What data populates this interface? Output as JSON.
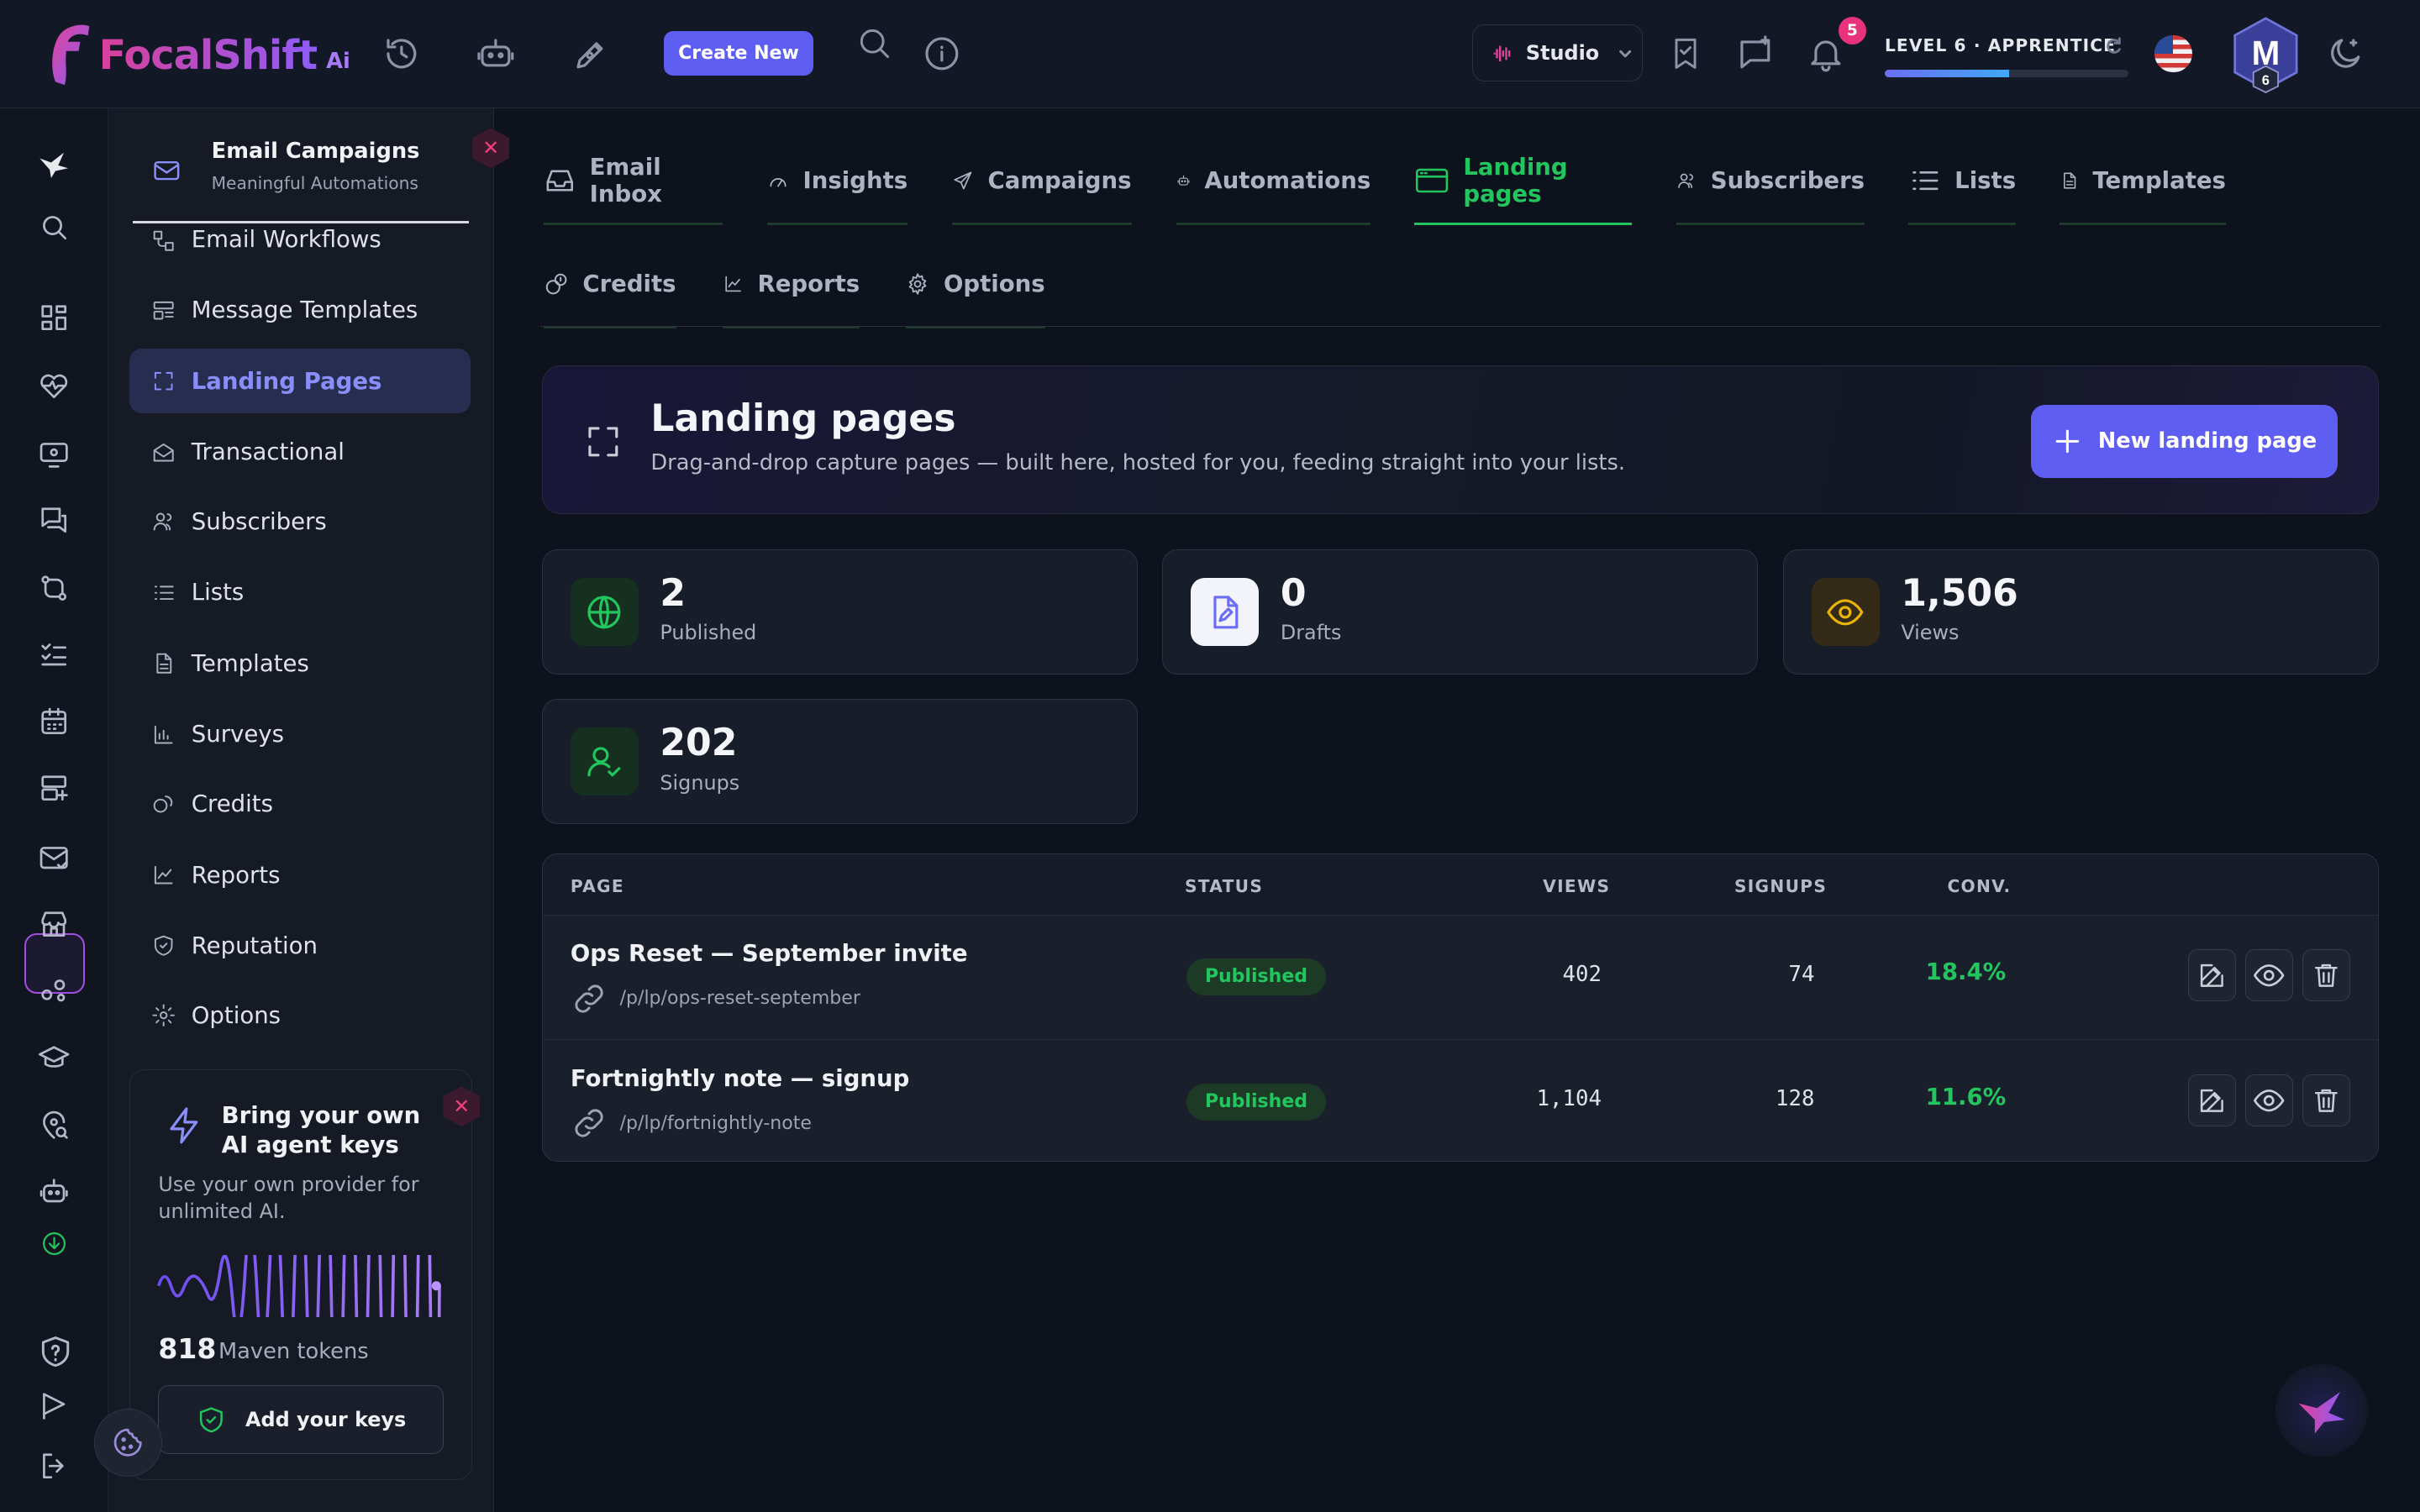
{
  "app": {
    "logo_text": "FocalShift",
    "logo_ai": "Ai"
  },
  "topbar": {
    "create_label": "Create New",
    "studio_label": "Studio",
    "notifications_count": "5",
    "level_label": "LEVEL 6 · APPRENTICE",
    "level_progress": 0.51,
    "avatar_initial": "M",
    "avatar_level": "6"
  },
  "sidebar": {
    "title": "Email Campaigns",
    "subtitle": "Meaningful Automations",
    "items": [
      {
        "label": "Email Workflows",
        "icon": "workflow-icon"
      },
      {
        "label": "Message Templates",
        "icon": "template-icon"
      },
      {
        "label": "Landing Pages",
        "icon": "frame-icon",
        "active": true
      },
      {
        "label": "Transactional",
        "icon": "envelope-open-icon"
      },
      {
        "label": "Subscribers",
        "icon": "users-icon"
      },
      {
        "label": "Lists",
        "icon": "list-icon"
      },
      {
        "label": "Templates",
        "icon": "document-icon"
      },
      {
        "label": "Surveys",
        "icon": "bar-chart-icon"
      },
      {
        "label": "Credits",
        "icon": "coins-icon"
      },
      {
        "label": "Reports",
        "icon": "line-chart-icon"
      },
      {
        "label": "Reputation",
        "icon": "shield-icon"
      },
      {
        "label": "Options",
        "icon": "gear-icon"
      }
    ],
    "promo": {
      "title": "Bring your own AI agent keys",
      "text": "Use your own provider for unlimited AI.",
      "tokens": "818",
      "tokens_label": "Maven tokens",
      "button": "Add your keys"
    }
  },
  "tabs_row1": [
    {
      "label": "Email Inbox",
      "icon": "inbox-icon"
    },
    {
      "label": "Insights",
      "icon": "gauge-icon"
    },
    {
      "label": "Campaigns",
      "icon": "send-icon"
    },
    {
      "label": "Automations",
      "icon": "robot-icon"
    },
    {
      "label": "Landing pages",
      "icon": "browser-icon",
      "active": true
    },
    {
      "label": "Subscribers",
      "icon": "users-icon"
    },
    {
      "label": "Lists",
      "icon": "list-icon"
    },
    {
      "label": "Templates",
      "icon": "document-icon"
    }
  ],
  "tabs_row2": [
    {
      "label": "Credits",
      "icon": "coins-icon"
    },
    {
      "label": "Reports",
      "icon": "line-chart-icon"
    },
    {
      "label": "Options",
      "icon": "gear-icon"
    }
  ],
  "hero": {
    "title": "Landing pages",
    "subtitle": "Drag-and-drop capture pages — built here, hosted for you, feeding straight into your lists.",
    "button": "New landing page"
  },
  "stats": [
    {
      "value": "2",
      "label": "Published",
      "icon": "globe-icon",
      "color": "#22c55e"
    },
    {
      "value": "0",
      "label": "Drafts",
      "icon": "file-edit-icon",
      "color": "#6c6df5"
    },
    {
      "value": "1,506",
      "label": "Views",
      "icon": "eye-icon",
      "color": "#eab308"
    },
    {
      "value": "202",
      "label": "Signups",
      "icon": "user-check-icon",
      "color": "#22c55e"
    }
  ],
  "table": {
    "headers": {
      "page": "PAGE",
      "status": "STATUS",
      "views": "VIEWS",
      "signups": "SIGNUPS",
      "conv": "CONV."
    },
    "rows": [
      {
        "name": "Ops Reset — September invite",
        "url": "/p/lp/ops-reset-september",
        "status": "Published",
        "views": "402",
        "signups": "74",
        "conv": "18.4%"
      },
      {
        "name": "Fortnightly note — signup",
        "url": "/p/lp/fortnightly-note",
        "status": "Published",
        "views": "1,104",
        "signups": "128",
        "conv": "11.6%"
      }
    ]
  },
  "colors": {
    "accent": "#5f5ef2",
    "success": "#22c55e",
    "danger": "#e8327c",
    "background": "#0e121c"
  }
}
